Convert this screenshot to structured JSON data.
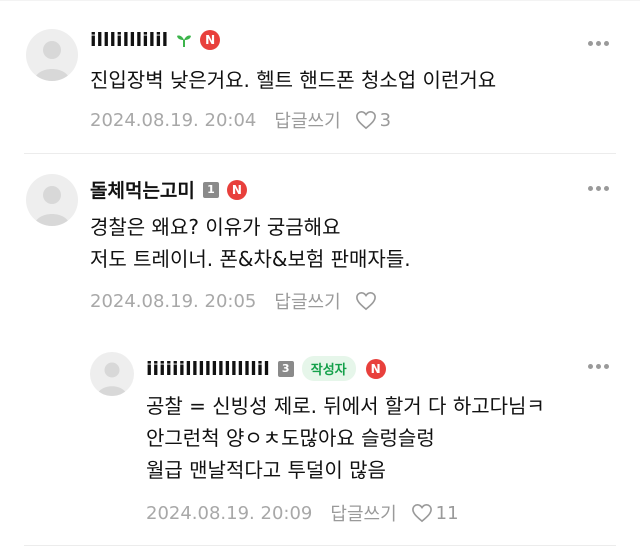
{
  "comments": [
    {
      "nickname": "illlilllilil",
      "badge": "N",
      "lines": [
        "진입장벽 낮은거요. 헬트 핸드폰 청소업 이런거요"
      ],
      "date": "2024.08.19. 20:04",
      "reply_label": "답글쓰기",
      "likes": "3"
    },
    {
      "nickname": "돌체먹는고미",
      "level": "1",
      "badge": "N",
      "lines": [
        "경찰은 왜요? 이유가 궁금해요",
        "저도 트레이너. 폰&차&보험 판매자들."
      ],
      "date": "2024.08.19. 20:05",
      "reply_label": "답글쓰기",
      "likes": ""
    },
    {
      "nickname": "iiiiiilllllllllllil",
      "level": "3",
      "writer_label": "작성자",
      "badge": "N",
      "lines": [
        "공찰 = 신빙성 제로. 뒤에서 할거 다 하고다님ㅋ",
        "안그런척 양ㅇㅊ도많아요 슬렁슬렁",
        "월급 맨날적다고 투덜이 많음"
      ],
      "date": "2024.08.19. 20:09",
      "reply_label": "답글쓰기",
      "likes": "11"
    }
  ],
  "colors": {
    "badge": "#e8403c",
    "writer_bg": "#e6f6ea",
    "writer_text": "#14a04a",
    "sprout": "#3cb44b"
  }
}
